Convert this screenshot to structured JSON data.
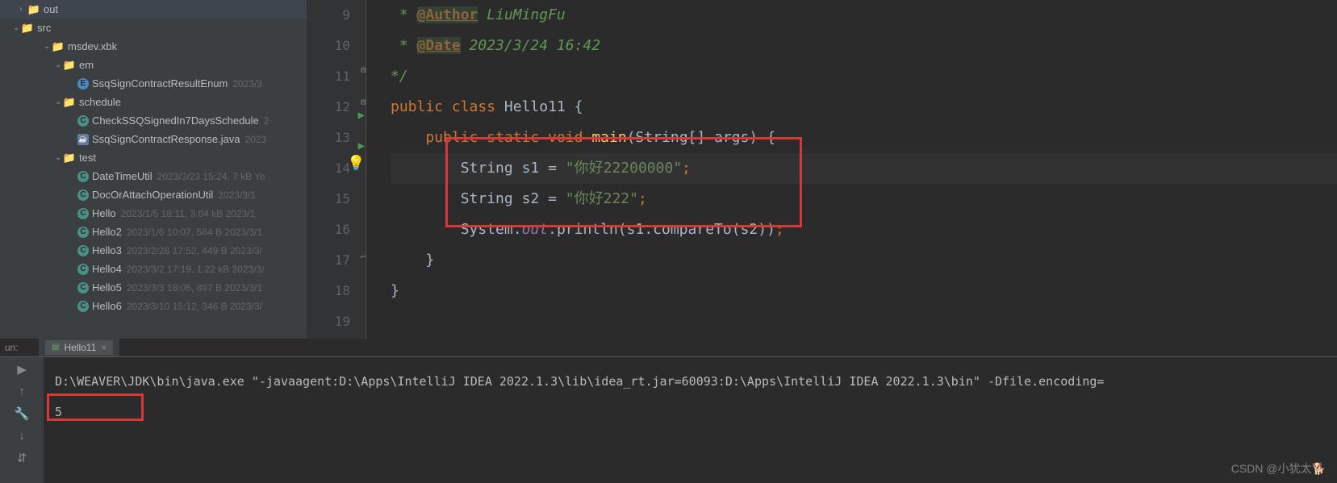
{
  "sidebar": {
    "items": [
      {
        "indent": 24,
        "chev": "",
        "iconClass": "folder-orange",
        "iconGlyph": "📁",
        "label": "out",
        "meta": ""
      },
      {
        "indent": 16,
        "chev": "⌄",
        "iconClass": "folder-blue",
        "iconGlyph": "📁",
        "label": "src",
        "meta": ""
      },
      {
        "indent": 54,
        "chev": "⌄",
        "iconClass": "folder-gray",
        "iconGlyph": "📁",
        "label": "msdev.xbk",
        "meta": ""
      },
      {
        "indent": 68,
        "chev": "⌄",
        "iconClass": "folder-gray",
        "iconGlyph": "📁",
        "label": "em",
        "meta": ""
      },
      {
        "indent": 96,
        "chev": "",
        "iconClass": "icon-e",
        "iconGlyph": "E",
        "label": "SsqSignContractResultEnum",
        "meta": "2023/3"
      },
      {
        "indent": 68,
        "chev": "⌄",
        "iconClass": "folder-gray",
        "iconGlyph": "📁",
        "label": "schedule",
        "meta": ""
      },
      {
        "indent": 96,
        "chev": "",
        "iconClass": "icon-c",
        "iconGlyph": "C",
        "label": "CheckSSQSignedIn7DaysSchedule",
        "meta": "2"
      },
      {
        "indent": 96,
        "chev": "",
        "iconClass": "icon-j",
        "iconGlyph": "J",
        "label": "SsqSignContractResponse.java",
        "meta": "2023"
      },
      {
        "indent": 68,
        "chev": "⌄",
        "iconClass": "folder-gray",
        "iconGlyph": "📁",
        "label": "test",
        "meta": ""
      },
      {
        "indent": 96,
        "chev": "",
        "iconClass": "icon-c",
        "iconGlyph": "C",
        "label": "DateTimeUtil",
        "meta": "2023/3/23 15:24, 7 kB Ye"
      },
      {
        "indent": 96,
        "chev": "",
        "iconClass": "icon-c",
        "iconGlyph": "C",
        "label": "DocOrAttachOperationUtil",
        "meta": "2023/3/1"
      },
      {
        "indent": 96,
        "chev": "",
        "iconClass": "icon-c",
        "iconGlyph": "C",
        "label": "Hello",
        "meta": "2023/1/5 18:11, 3.04 kB 2023/1"
      },
      {
        "indent": 96,
        "chev": "",
        "iconClass": "icon-c",
        "iconGlyph": "C",
        "label": "Hello2",
        "meta": "2023/1/6 10:07, 564 B 2023/3/1"
      },
      {
        "indent": 96,
        "chev": "",
        "iconClass": "icon-c",
        "iconGlyph": "C",
        "label": "Hello3",
        "meta": "2023/2/28 17:52, 449 B 2023/3/"
      },
      {
        "indent": 96,
        "chev": "",
        "iconClass": "icon-c",
        "iconGlyph": "C",
        "label": "Hello4",
        "meta": "2023/3/2 17:19, 1.22 kB 2023/3/"
      },
      {
        "indent": 96,
        "chev": "",
        "iconClass": "icon-c",
        "iconGlyph": "C",
        "label": "Hello5",
        "meta": "2023/3/3 18:06, 897 B 2023/3/1"
      },
      {
        "indent": 96,
        "chev": "",
        "iconClass": "icon-c",
        "iconGlyph": "C",
        "label": "Hello6",
        "meta": "2023/3/10 15:12, 346 B 2023/3/"
      }
    ]
  },
  "gutter": [
    "9",
    "10",
    "11",
    "12",
    "13",
    "14",
    "15",
    "16",
    "17",
    "18",
    "19"
  ],
  "code": {
    "author_tag": "@Author",
    "author_val": "LiuMingFu",
    "date_tag": "@Date",
    "date_val": "2023/3/24 16:42",
    "close_comment": "*/",
    "kw_public": "public",
    "kw_class": "class",
    "class_name": "Hello11",
    "kw_static": "static",
    "kw_void": "void",
    "method_main": "main",
    "type_string_arr": "String[]",
    "param_args": "args",
    "type_string": "String",
    "var_s1": "s1",
    "s1_val": "\"你好22200000\"",
    "var_s2": "s2",
    "s2_val": "\"你好222\"",
    "sys": "System",
    "out": "out",
    "println": "println",
    "compare": "compareTo"
  },
  "run": {
    "label": "un:",
    "tab_name": "Hello11",
    "command": "D:\\WEAVER\\JDK\\bin\\java.exe \"-javaagent:D:\\Apps\\IntelliJ IDEA 2022.1.3\\lib\\idea_rt.jar=60093:D:\\Apps\\IntelliJ IDEA 2022.1.3\\bin\" -Dfile.encoding=",
    "output": "5"
  },
  "watermark": "CSDN @小犹太🐕"
}
